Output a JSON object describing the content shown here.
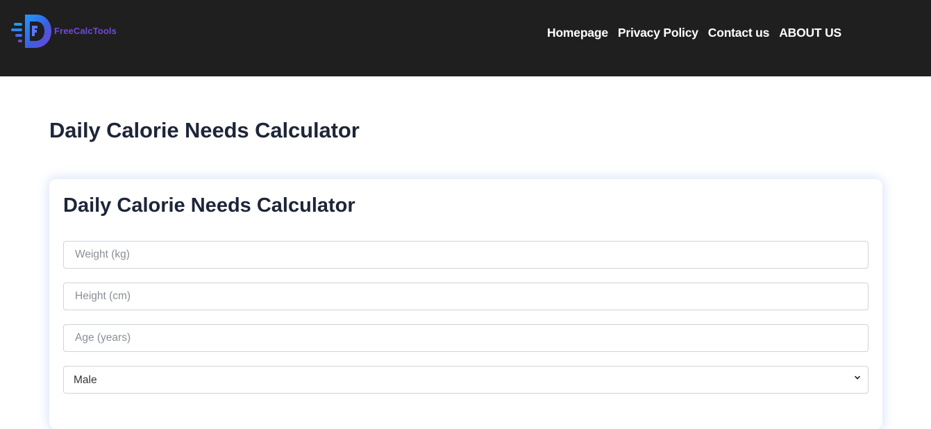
{
  "header": {
    "logo_text": "FreeCalcTools",
    "nav": [
      {
        "label": "Homepage"
      },
      {
        "label": "Privacy Policy"
      },
      {
        "label": "Contact us"
      },
      {
        "label": "ABOUT US"
      }
    ]
  },
  "main": {
    "page_title": "Daily Calorie Needs Calculator",
    "card": {
      "title": "Daily Calorie Needs Calculator",
      "weight": {
        "placeholder": "Weight (kg)",
        "value": ""
      },
      "height": {
        "placeholder": "Height (cm)",
        "value": ""
      },
      "age": {
        "placeholder": "Age (years)",
        "value": ""
      },
      "gender": {
        "selected": "Male",
        "options": [
          "Male"
        ]
      }
    }
  },
  "colors": {
    "header_bg": "#1f1f20",
    "title_text": "#1d2538",
    "logo_accent": "#6d4bd8",
    "logo_blue": "#2f7fe0"
  }
}
